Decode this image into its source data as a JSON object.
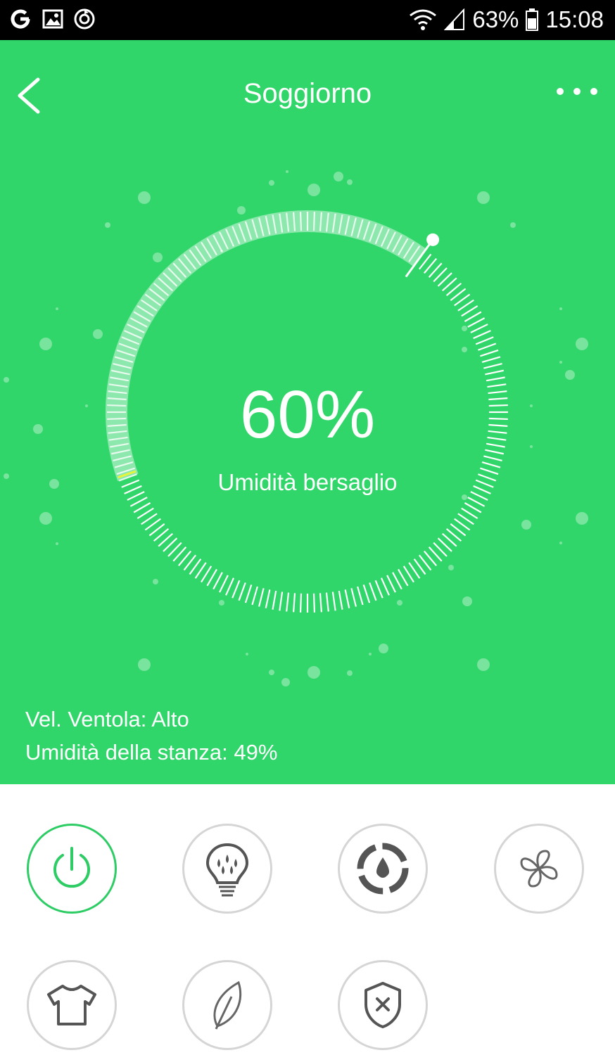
{
  "status_bar": {
    "battery": "63%",
    "time": "15:08",
    "icons": [
      "google-icon",
      "gallery-icon",
      "sync-icon",
      "wifi-icon",
      "signal-icon",
      "battery-icon"
    ]
  },
  "header": {
    "title": "Soggiorno",
    "back_icon": "back-chevron-icon",
    "more_icon": "more-dots-icon"
  },
  "dial": {
    "value": "60%",
    "label": "Umidità bersaglio",
    "target_fraction": 0.6,
    "accent_color": "#31d66a"
  },
  "info": {
    "fan_speed": "Vel. Ventola: Alto",
    "room_humidity": "Umidità della stanza: 49%"
  },
  "controls": [
    {
      "name": "power",
      "icon": "power-icon",
      "active": true
    },
    {
      "name": "light",
      "icon": "bulb-drops-icon",
      "active": false
    },
    {
      "name": "auto-humidity",
      "icon": "drop-cycle-icon",
      "active": false
    },
    {
      "name": "fan",
      "icon": "fan-icon",
      "active": false
    },
    {
      "name": "clothes-mode",
      "icon": "shirt-icon",
      "active": false
    },
    {
      "name": "eco-mode",
      "icon": "leaf-icon",
      "active": false
    },
    {
      "name": "child-lock",
      "icon": "shield-x-icon",
      "active": false
    }
  ]
}
